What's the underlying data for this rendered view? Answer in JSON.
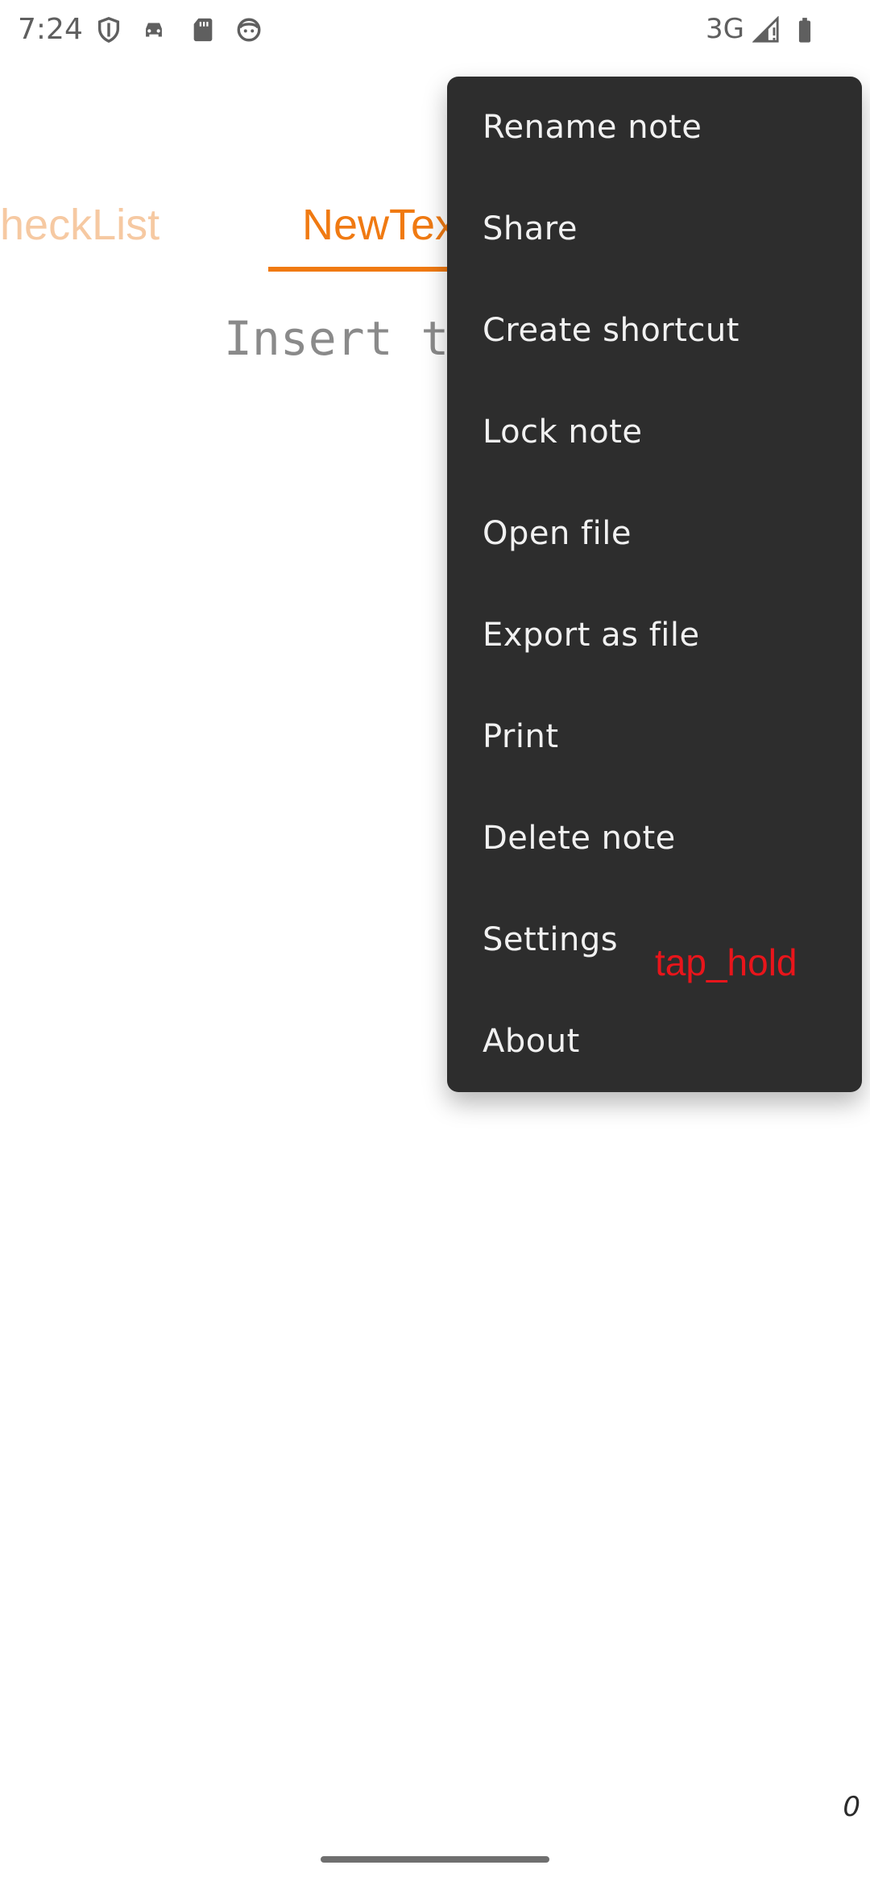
{
  "status_bar": {
    "time": "7:24",
    "network": "3G",
    "icons": [
      "shield-icon",
      "car-icon",
      "sd-card-icon",
      "face-icon",
      "signal-icon",
      "battery-icon"
    ]
  },
  "tabs": [
    {
      "label": "CheckList",
      "visible_text": "heckList",
      "state": "inactive"
    },
    {
      "label": "NewText",
      "visible_text": "NewTex",
      "state": "active"
    }
  ],
  "editor": {
    "placeholder": "Insert te"
  },
  "menu": {
    "items": [
      {
        "label": "Rename note"
      },
      {
        "label": "Share"
      },
      {
        "label": "Create shortcut"
      },
      {
        "label": "Lock note"
      },
      {
        "label": "Open file"
      },
      {
        "label": "Export as file"
      },
      {
        "label": "Print"
      },
      {
        "label": "Delete note"
      },
      {
        "label": "Settings"
      },
      {
        "label": "About"
      }
    ]
  },
  "overlay": {
    "text": "tap_hold"
  },
  "footer": {
    "char_count": "0"
  },
  "colors": {
    "accent": "#f07a12",
    "accent_faded": "#f6c9a2",
    "menu_background": "#2d2d2d",
    "overlay_text": "#e8151b"
  }
}
